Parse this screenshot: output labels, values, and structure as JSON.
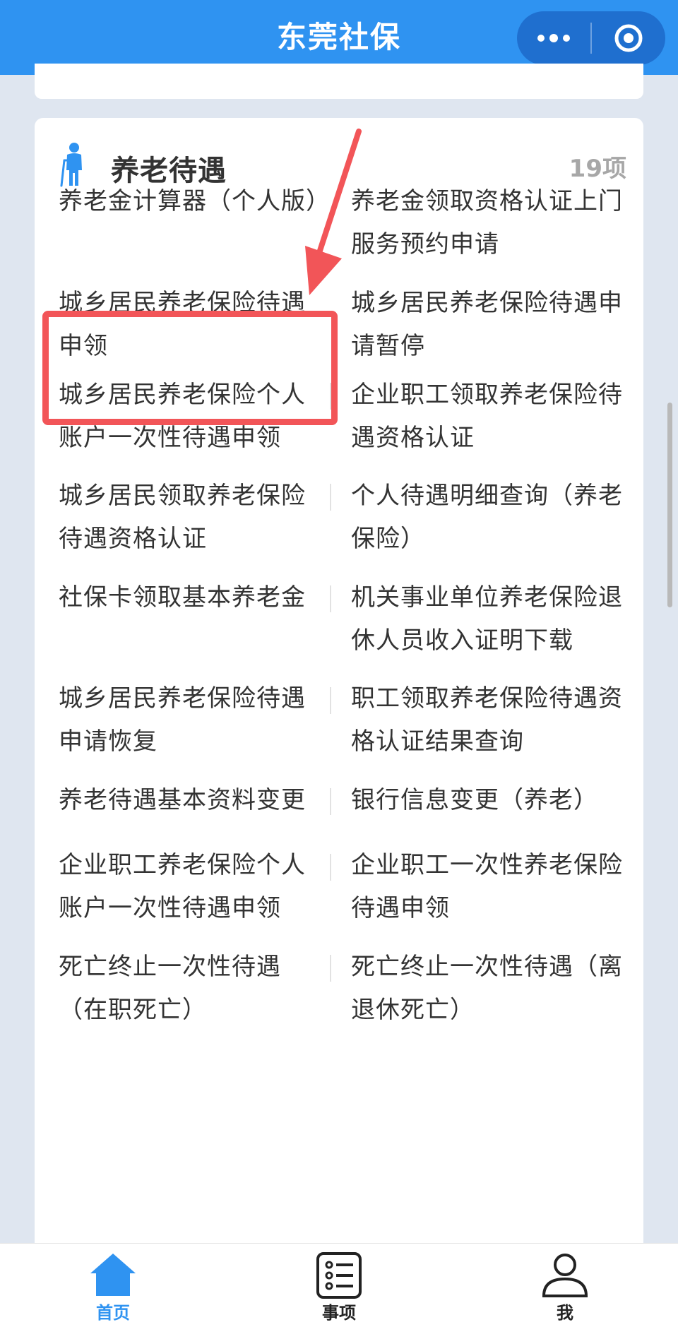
{
  "app": {
    "title": "东莞社保"
  },
  "capsule": {
    "more_icon": "more-dots-icon",
    "close_icon": "target-circle-icon"
  },
  "section": {
    "title": "养老待遇",
    "count": "19项",
    "icon": "elderly-person-icon"
  },
  "items": [
    {
      "left": "养老金计算器（个人版）",
      "right": "养老金领取资格认证上门服务预约申请"
    },
    {
      "left": "城乡居民养老保险待遇申领",
      "right": "城乡居民养老保险待遇申请暂停"
    },
    {
      "left": "城乡居民养老保险个人账户一次性待遇申领",
      "right": "企业职工领取养老保险待遇资格认证"
    },
    {
      "left": "城乡居民领取养老保险待遇资格认证",
      "right": "个人待遇明细查询（养老保险）"
    },
    {
      "left": "社保卡领取基本养老金",
      "right": "机关事业单位养老保险退休人员收入证明下载"
    },
    {
      "left": "城乡居民养老保险待遇申请恢复",
      "right": "职工领取养老保险待遇资格认证结果查询"
    },
    {
      "left": "养老待遇基本资料变更",
      "right": "银行信息变更（养老）"
    },
    {
      "left": "企业职工养老保险个人账户一次性待遇申领",
      "right": "企业职工一次性养老保险待遇申领"
    },
    {
      "left": "死亡终止一次性待遇（在职死亡）",
      "right": "死亡终止一次性待遇（离退休死亡）"
    }
  ],
  "tabs": [
    {
      "label": "首页",
      "icon": "home-icon",
      "active": true
    },
    {
      "label": "事项",
      "icon": "list-icon",
      "active": false
    },
    {
      "label": "我",
      "icon": "user-icon",
      "active": false
    }
  ],
  "colors": {
    "primary": "#2f93f1",
    "annotation": "#f25558",
    "text": "#333333",
    "muted": "#a7a7a7"
  }
}
